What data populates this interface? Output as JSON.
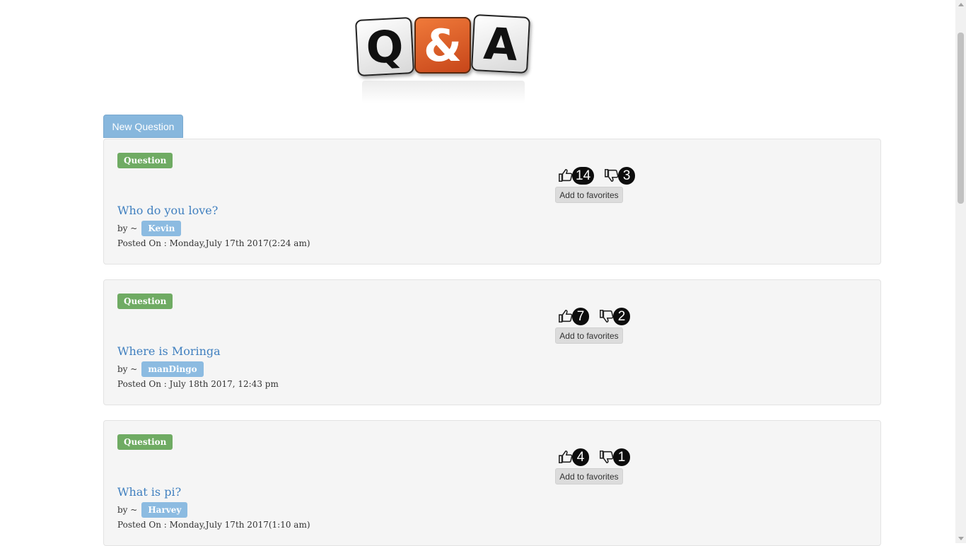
{
  "logo": {
    "letters": [
      "Q",
      "&",
      "A"
    ],
    "colors": {
      "q": "#ffffff",
      "amp": "#e0622a",
      "a": "#ffffff"
    }
  },
  "actions": {
    "new_question": "New Question"
  },
  "colors": {
    "label_green": "#6fab63",
    "title_link": "#3f7fbf",
    "author_badge": "#8cbbe1",
    "count_badge": "#0d0d0d"
  },
  "questions": [
    {
      "label": "Question",
      "title": "Who do you love?",
      "by": "by ~",
      "author": "Kevin",
      "posted": "Posted On : Monday,July 17th 2017(2:24 am)",
      "likes": "14",
      "dislikes": "3",
      "favorite": "Add to favorites"
    },
    {
      "label": "Question",
      "title": "Where is Moringa",
      "by": "by ~",
      "author": "manDingo",
      "posted": "Posted On : July 18th 2017, 12:43 pm",
      "likes": "7",
      "dislikes": "2",
      "favorite": "Add to favorites"
    },
    {
      "label": "Question",
      "title": "What is pi?",
      "by": "by ~",
      "author": "Harvey",
      "posted": "Posted On : Monday,July 17th 2017(1:10 am)",
      "likes": "4",
      "dislikes": "1",
      "favorite": "Add to favorites"
    }
  ]
}
